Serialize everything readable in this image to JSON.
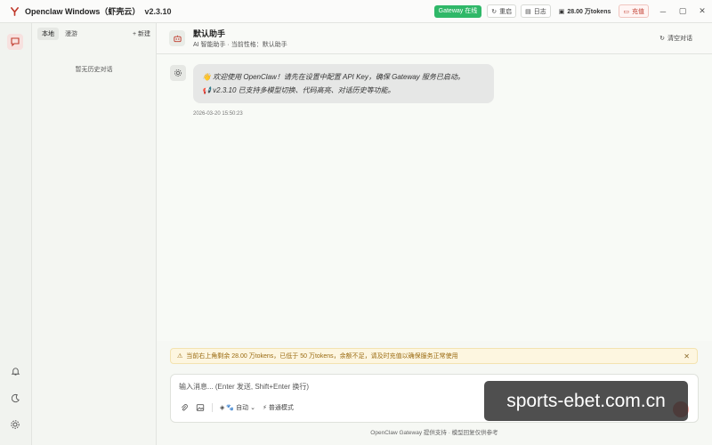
{
  "app": {
    "title": "Openclaw Windows（虾壳云）",
    "version": "v2.3.10"
  },
  "titlebar": {
    "gateway_status": "Gateway 在线",
    "restart_label": "重启",
    "logs_label": "日志",
    "tokens_label": "28.00 万tokens",
    "recharge_label": "充值"
  },
  "history": {
    "tabs": [
      "本地",
      "漫游"
    ],
    "new_label": "+ 新建",
    "empty_text": "暂无历史对话"
  },
  "header": {
    "title": "默认助手",
    "subtitle": "AI 智能助手 · 当前性格：默认助手",
    "clear_label": "清空对话"
  },
  "messages": [
    {
      "line1": "👋 欢迎使用 OpenClaw！请先在设置中配置 API Key，确保 Gateway 服务已启动。",
      "line2": "📢 v2.3.10 已支持多模型切换、代码高亮、对话历史等功能。",
      "time": "2026-03-20 15:50:23"
    }
  ],
  "warning": {
    "text": "当前右上角剩余 28.00 万tokens，已低于 50 万tokens，余额不足，请及时充值以确保服务正常使用"
  },
  "composer": {
    "placeholder": "输入消息... (Enter 发送, Shift+Enter 换行)",
    "model_label": "自动",
    "mode_label": "普通模式"
  },
  "footer": {
    "text": "OpenClaw Gateway 提供支持 · 模型回复仅供参考"
  },
  "watermark": {
    "text": "sports-ebet.com.cn"
  },
  "colors": {
    "accent": "#c0392b",
    "online": "#2fb868",
    "warning_bg": "#fdf6e0"
  }
}
